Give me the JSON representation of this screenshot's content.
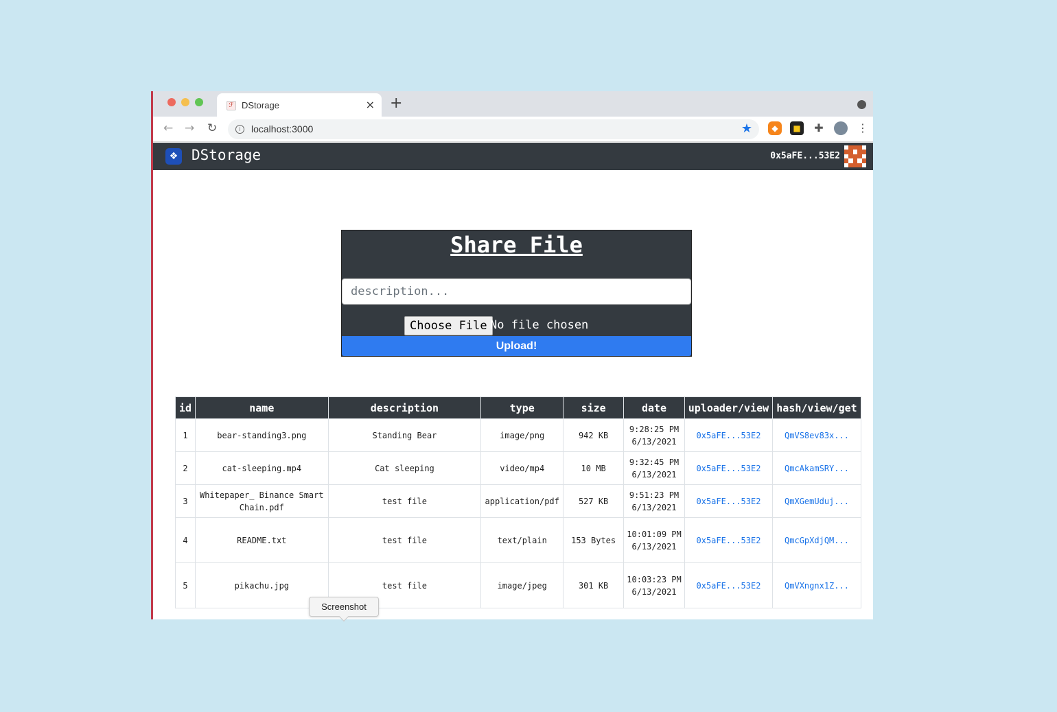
{
  "browser": {
    "tab_title": "DStorage",
    "tab_close": "×",
    "new_tab": "+",
    "url": "localhost:3000",
    "nav": {
      "back": "←",
      "forward": "→",
      "reload": "↻"
    },
    "bookmark_star": "★"
  },
  "app": {
    "brand": "DStorage",
    "account": "0x5aFE...53E2",
    "identicon_colors": [
      "#d45f2e",
      "#ffffff"
    ]
  },
  "form": {
    "title": "Share File",
    "description_placeholder": "description...",
    "choose_file_label": "Choose File",
    "no_file_text": "No file chosen",
    "upload_label": "Upload!"
  },
  "table": {
    "headers": [
      "id",
      "name",
      "description",
      "type",
      "size",
      "date",
      "uploader/view",
      "hash/view/get"
    ],
    "rows": [
      {
        "id": "1",
        "name": "bear-standing3.png",
        "description": "Standing Bear",
        "type": "image/png",
        "size": "942 KB",
        "date_time": "9:28:25 PM",
        "date_day": "6/13/2021",
        "uploader": "0x5aFE...53E2",
        "hash": "QmVS8ev83x..."
      },
      {
        "id": "2",
        "name": "cat-sleeping.mp4",
        "description": "Cat sleeping",
        "type": "video/mp4",
        "size": "10 MB",
        "date_time": "9:32:45 PM",
        "date_day": "6/13/2021",
        "uploader": "0x5aFE...53E2",
        "hash": "QmcAkamSRY..."
      },
      {
        "id": "3",
        "name": "Whitepaper_ Binance Smart Chain.pdf",
        "description": "test file",
        "type": "application/pdf",
        "size": "527 KB",
        "date_time": "9:51:23 PM",
        "date_day": "6/13/2021",
        "uploader": "0x5aFE...53E2",
        "hash": "QmXGemUduj..."
      },
      {
        "id": "4",
        "name": "README.txt",
        "description": "test file",
        "type": "text/plain",
        "size": "153 Bytes",
        "date_time": "10:01:09 PM",
        "date_day": "6/13/2021",
        "uploader": "0x5aFE...53E2",
        "hash": "QmcGpXdjQM..."
      },
      {
        "id": "5",
        "name": "pikachu.jpg",
        "description": "test file",
        "type": "image/jpeg",
        "size": "301 KB",
        "date_time": "10:03:23 PM",
        "date_day": "6/13/2021",
        "uploader": "0x5aFE...53E2",
        "hash": "QmVXngnx1Z..."
      }
    ]
  },
  "tooltip": {
    "text": "Screenshot"
  }
}
